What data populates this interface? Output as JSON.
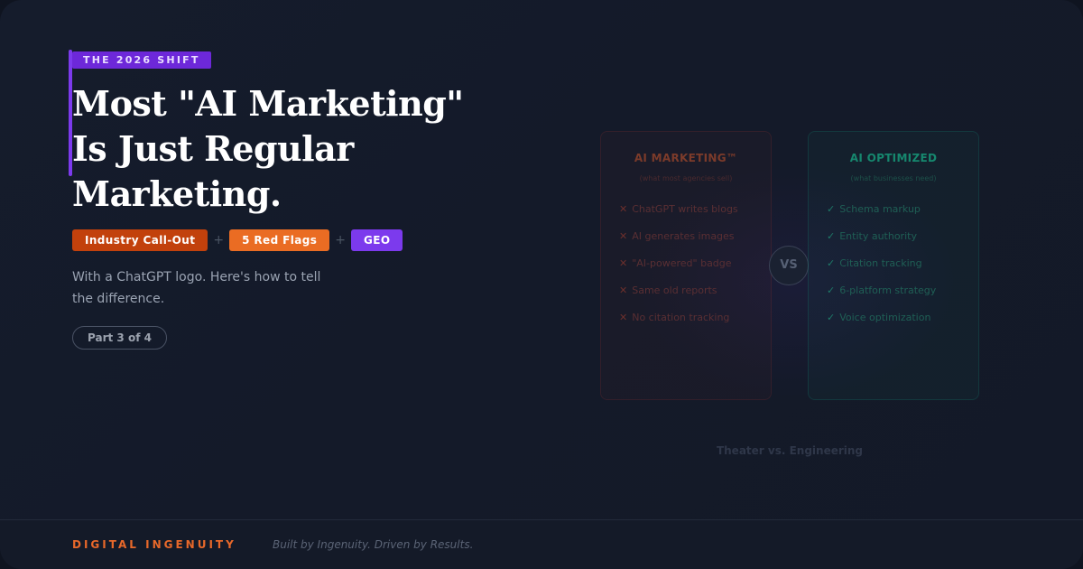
{
  "hero": {
    "eyebrow": "THE 2026 SHIFT",
    "headline_lines": [
      "Most \"AI Marketing\"",
      "Is Just Regular",
      "Marketing."
    ],
    "tags": [
      "Industry Call-Out",
      "5 Red Flags",
      "GEO"
    ],
    "tag_separator": "+",
    "subtext_lines": [
      "With a ChatGPT logo. Here's how to tell",
      "the difference."
    ],
    "part_label": "Part 3 of 4"
  },
  "comparison": {
    "left_card": {
      "title": "AI MARKETING™",
      "subtitle": "(what most agencies sell)",
      "mark": "✕",
      "items": [
        "ChatGPT writes blogs",
        "AI generates images",
        "\"AI-powered\" badge",
        "Same old reports",
        "No citation tracking"
      ]
    },
    "right_card": {
      "title": "AI OPTIMIZED",
      "subtitle": "(what businesses need)",
      "mark": "✓",
      "items": [
        "Schema markup",
        "Entity authority",
        "Citation tracking",
        "6-platform strategy",
        "Voice optimization"
      ]
    },
    "vs_label": "VS",
    "caption": "Theater vs. Engineering"
  },
  "footer": {
    "brand": "DIGITAL INGENUITY",
    "tagline": "Built by Ingenuity. Driven by Results."
  },
  "colors": {
    "background": "#141a29",
    "accent_purple": "#7c3aed",
    "accent_orange": "#ea6c23",
    "accent_red_orange": "#c2410c",
    "optimized_green": "#16876e"
  }
}
